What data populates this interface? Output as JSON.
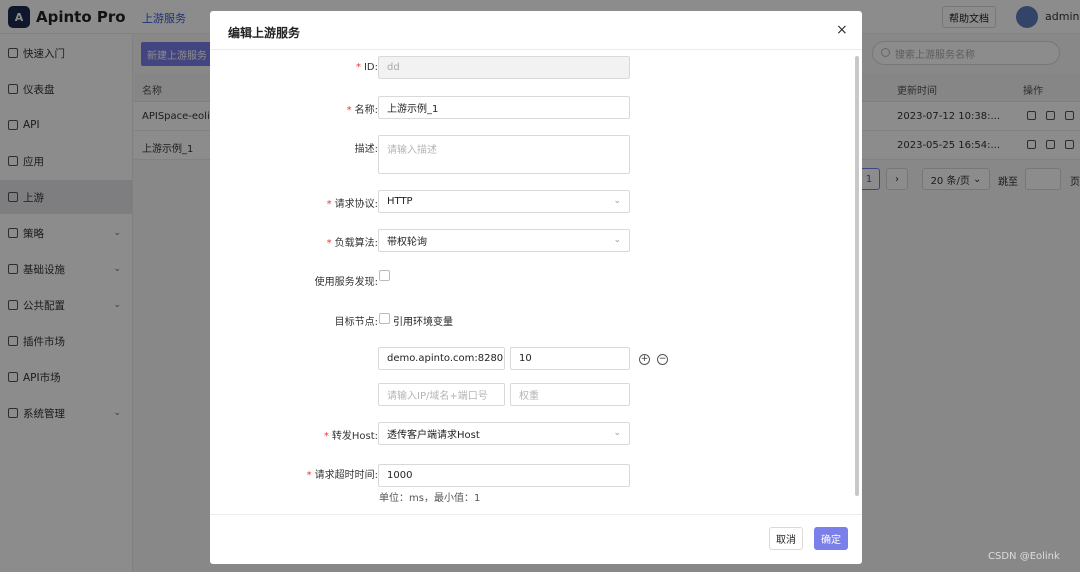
{
  "app": {
    "logo_letter": "A",
    "name": "Apinto Pro"
  },
  "header": {
    "breadcrumb": "上游服务",
    "help_label": "帮助文档",
    "user_name": "admin"
  },
  "sidebar": {
    "items": [
      {
        "label": "快速入门"
      },
      {
        "label": "仪表盘"
      },
      {
        "label": "API"
      },
      {
        "label": "应用"
      },
      {
        "label": "上游"
      },
      {
        "label": "策略"
      },
      {
        "label": "基础设施"
      },
      {
        "label": "公共配置"
      },
      {
        "label": "插件市场"
      },
      {
        "label": "API市场"
      },
      {
        "label": "系统管理"
      }
    ]
  },
  "toolbar": {
    "new_label": "新建上游服务",
    "search_placeholder": "搜索上游服务名称"
  },
  "table": {
    "headers": {
      "name": "名称",
      "updated": "更新时间",
      "actions": "操作"
    },
    "rows": [
      {
        "name": "APISpace-eolink",
        "updated": "2023-07-12 10:38:..."
      },
      {
        "name": "上游示例_1",
        "updated": "2023-05-25 16:54:..."
      }
    ]
  },
  "pagination": {
    "current": "1",
    "next": "›",
    "page_size": "20 条/页",
    "jump_label": "跳至",
    "page_suffix": "页"
  },
  "modal": {
    "title": "编辑上游服务",
    "close": "×",
    "fields": {
      "id": {
        "label": "ID:",
        "value": "dd"
      },
      "name": {
        "label": "名称:",
        "value": "上游示例_1"
      },
      "desc": {
        "label": "描述:",
        "placeholder": "请输入描述"
      },
      "protocol": {
        "label": "请求协议:",
        "value": "HTTP"
      },
      "balance": {
        "label": "负载算法:",
        "value": "带权轮询"
      },
      "discovery": {
        "label": "使用服务发现:"
      },
      "nodes": {
        "label": "目标节点:",
        "env_label": "引用环境变量",
        "node_addr": "demo.apinto.com:8280",
        "node_weight": "10",
        "addr_placeholder": "请输入IP/域名+端口号",
        "weight_placeholder": "权重",
        "add_symbol": "+",
        "remove_symbol": "−"
      },
      "host": {
        "label": "转发Host:",
        "value": "透传客户端请求Host"
      },
      "timeout": {
        "label": "请求超时时间:",
        "value": "1000",
        "hint": "单位：ms，最小值：1"
      }
    },
    "cancel_label": "取消",
    "ok_label": "确定"
  },
  "watermark": "CSDN @Eolink"
}
